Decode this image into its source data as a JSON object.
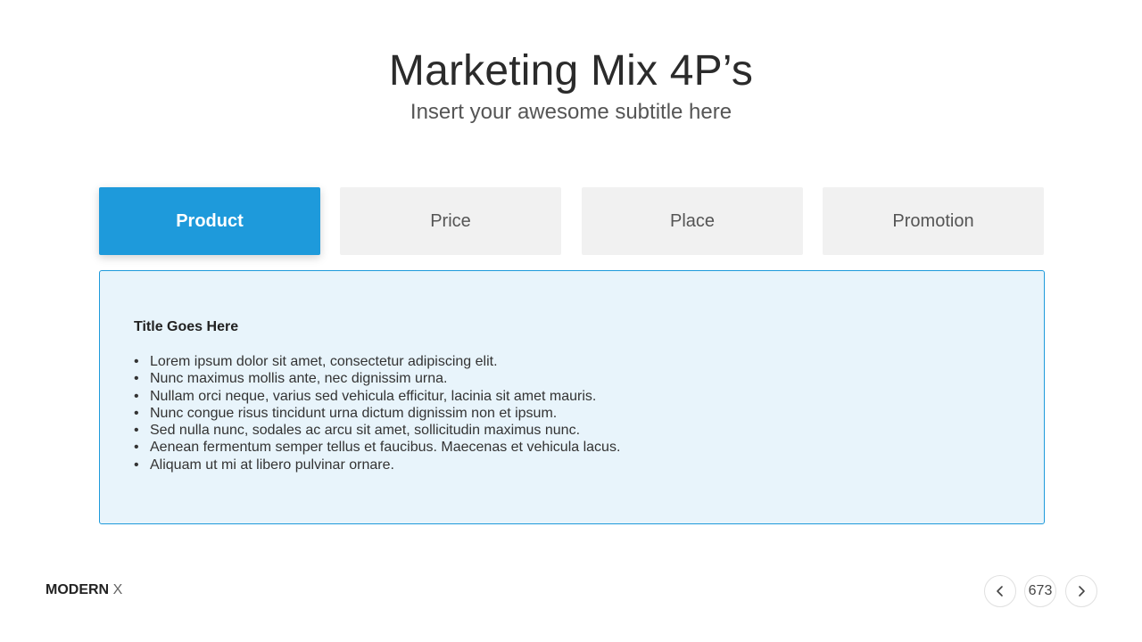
{
  "header": {
    "title": "Marketing Mix 4P’s",
    "subtitle": "Insert your awesome subtitle here"
  },
  "tabs": [
    {
      "label": "Product",
      "active": true
    },
    {
      "label": "Price",
      "active": false
    },
    {
      "label": "Place",
      "active": false
    },
    {
      "label": "Promotion",
      "active": false
    }
  ],
  "panel": {
    "title": "Title Goes Here",
    "items": [
      "Lorem ipsum dolor sit amet, consectetur adipiscing elit.",
      "Nunc maximus mollis ante, nec dignissim urna.",
      "Nullam orci neque, varius sed vehicula efficitur, lacinia sit amet mauris.",
      "Nunc congue risus tincidunt urna dictum dignissim non et ipsum.",
      "Sed nulla nunc, sodales ac arcu sit amet, sollicitudin maximus nunc.",
      "Aenean fermentum semper tellus et faucibus. Maecenas et vehicula lacus.",
      "Aliquam ut mi at libero pulvinar ornare."
    ]
  },
  "footer": {
    "brand_bold": "MODERN",
    "brand_light": "X",
    "page_number": "673",
    "prev_icon": "chevron-left-icon",
    "next_icon": "chevron-right-icon"
  },
  "colors": {
    "accent": "#1e9adb",
    "panel_bg": "#e8f4fb",
    "tab_inactive_bg": "#f1f1f1"
  }
}
